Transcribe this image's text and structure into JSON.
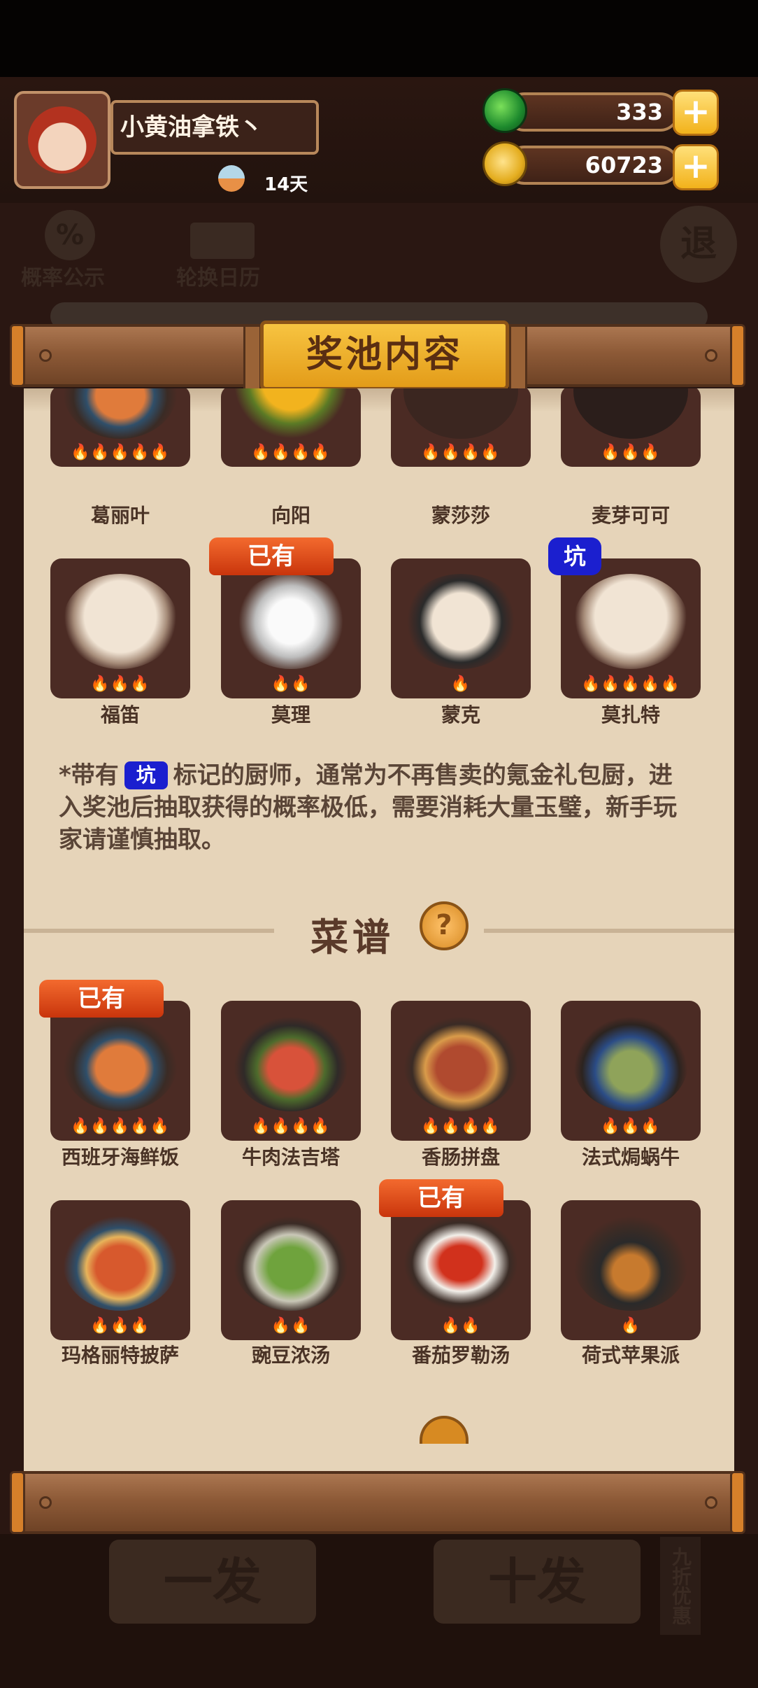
{
  "player": {
    "name": "小黄油拿铁丶",
    "days": "14天"
  },
  "resources": {
    "jade": "333",
    "coins": "60723"
  },
  "background_menu": {
    "probability_label": "概率公示",
    "calendar_label": "轮换日历",
    "exit_label": "退",
    "btn_one": "一发",
    "btn_ten": "十发",
    "discount": "九折优惠"
  },
  "panel": {
    "title": "奖池内容",
    "owned_label": "已有",
    "pit_label": "坑",
    "chefs_row1": [
      {
        "name": "葛丽叶",
        "stars": 5
      },
      {
        "name": "向阳",
        "stars": 4
      },
      {
        "name": "蒙莎莎",
        "stars": 4
      },
      {
        "name": "麦芽可可",
        "stars": 3
      }
    ],
    "chefs_row2": [
      {
        "name": "福笛",
        "stars": 3
      },
      {
        "name": "莫理",
        "stars": 2
      },
      {
        "name": "蒙克",
        "stars": 1
      },
      {
        "name": "莫扎特",
        "stars": 5
      }
    ],
    "note_prefix": "*带有",
    "note_suffix": "标记的厨师，通常为不再售卖的氪金礼包厨，进入奖池后抽取获得的概率极低，需要消耗大量玉璧，新手玩家请谨慎抽取。",
    "recipes_title": "菜谱",
    "help_glyph": "?",
    "recipes_row1": [
      {
        "name": "西班牙海鲜饭",
        "stars": 5
      },
      {
        "name": "牛肉法吉塔",
        "stars": 4
      },
      {
        "name": "香肠拼盘",
        "stars": 4
      },
      {
        "name": "法式焗蜗牛",
        "stars": 3
      }
    ],
    "recipes_row2": [
      {
        "name": "玛格丽特披萨",
        "stars": 3
      },
      {
        "name": "豌豆浓汤",
        "stars": 2
      },
      {
        "name": "番茄罗勒汤",
        "stars": 2
      },
      {
        "name": "荷式苹果派",
        "stars": 1
      }
    ]
  }
}
